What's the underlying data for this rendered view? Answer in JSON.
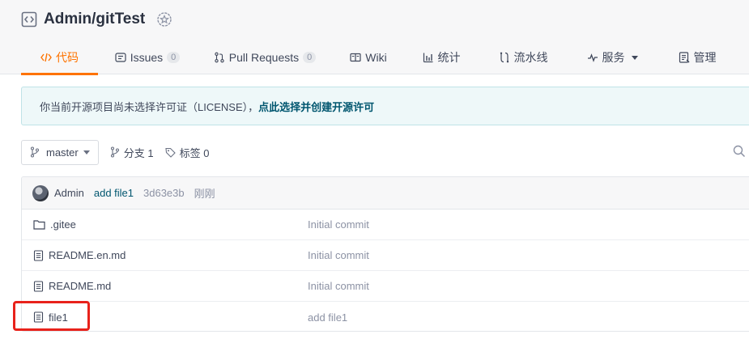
{
  "repo": {
    "name": "Admin/gitTest"
  },
  "tabs": [
    {
      "label": "代码",
      "icon": "code-icon",
      "active": true
    },
    {
      "label": "Issues",
      "count": "0",
      "icon": "issues-icon"
    },
    {
      "label": "Pull Requests",
      "count": "0",
      "icon": "pull-request-icon"
    },
    {
      "label": "Wiki",
      "icon": "wiki-icon"
    },
    {
      "label": "统计",
      "icon": "stats-icon"
    },
    {
      "label": "流水线",
      "icon": "pipeline-icon"
    },
    {
      "label": "服务",
      "icon": "service-icon"
    },
    {
      "label": "管理",
      "icon": "manage-icon"
    }
  ],
  "license": {
    "text": "你当前开源项目尚未选择许可证（LICENSE），",
    "link": "点此选择并创建开源许可"
  },
  "toolbar": {
    "branch": "master",
    "branches_label": "分支 1",
    "tags_label": "标签 0"
  },
  "commit": {
    "author": "Admin",
    "message": "add file1",
    "sha": "3d63e3b",
    "time": "刚刚"
  },
  "files": [
    {
      "name": ".gitee",
      "type": "folder",
      "message": "Initial commit"
    },
    {
      "name": "README.en.md",
      "type": "file",
      "message": "Initial commit"
    },
    {
      "name": "README.md",
      "type": "file",
      "message": "Initial commit"
    },
    {
      "name": "file1",
      "type": "file",
      "message": "add file1"
    }
  ],
  "colors": {
    "accent": "#fe7300",
    "link": "#00566f",
    "highlight": "#e8221b"
  }
}
